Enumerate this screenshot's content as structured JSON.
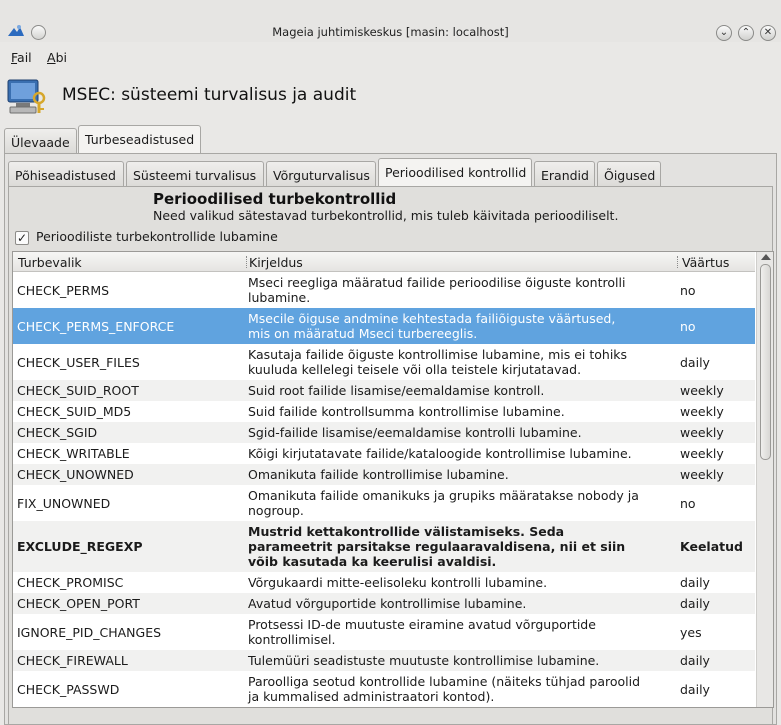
{
  "window": {
    "title": "Mageia juhtimiskeskus  [masin: localhost]"
  },
  "menu": {
    "file_rest": "ail",
    "file_key": "F",
    "help_rest": "bi",
    "help_key": "A"
  },
  "app": {
    "title": "MSEC: süsteemi turvalisus ja audit"
  },
  "top_tabs": [
    "Ülevaade",
    "Turbeseadistused"
  ],
  "sub_tabs": [
    "Põhiseadistused",
    "Süsteemi turvalisus",
    "Võrguturvalisus",
    "Perioodilised kontrollid",
    "Erandid",
    "Õigused"
  ],
  "section": {
    "title": "Perioodilised turbekontrollid",
    "description": "Need valikud sätestavad turbekontrollid, mis tuleb käivitada perioodiliselt.",
    "checkbox_label": "Perioodiliste turbekontrollide lubamine"
  },
  "table": {
    "columns": [
      "Turbevalik",
      "Kirjeldus",
      "Väärtus"
    ],
    "rows": [
      {
        "name": "CHECK_PERMS",
        "desc": [
          "Mseci reegliga määratud failide perioodilise õiguste kontrolli",
          "lubamine."
        ],
        "value": "no"
      },
      {
        "name": "CHECK_PERMS_ENFORCE",
        "desc": [
          "Msecile õiguse andmine kehtestada failiõiguste väärtused,",
          "mis on määratud Mseci turbereeglis."
        ],
        "value": "no"
      },
      {
        "name": "CHECK_USER_FILES",
        "desc": [
          "Kasutaja failide õiguste kontrollimise lubamine, mis ei tohiks",
          "kuuluda kellelegi teisele või olla teistele kirjutatavad."
        ],
        "value": "daily"
      },
      {
        "name": "CHECK_SUID_ROOT",
        "desc": [
          "Suid root failide lisamise/eemaldamise kontroll."
        ],
        "value": "weekly"
      },
      {
        "name": "CHECK_SUID_MD5",
        "desc": [
          "Suid failide kontrollsumma kontrollimise lubamine."
        ],
        "value": "weekly"
      },
      {
        "name": "CHECK_SGID",
        "desc": [
          "Sgid-failide lisamise/eemaldamise kontrolli lubamine."
        ],
        "value": "weekly"
      },
      {
        "name": "CHECK_WRITABLE",
        "desc": [
          "Kõigi kirjutatavate failide/kataloogide kontrollimise lubamine."
        ],
        "value": "weekly"
      },
      {
        "name": "CHECK_UNOWNED",
        "desc": [
          "Omanikuta failide kontrollimise lubamine."
        ],
        "value": "weekly"
      },
      {
        "name": "FIX_UNOWNED",
        "desc": [
          "Omanikuta failide omanikuks ja grupiks määratakse nobody ja",
          "nogroup."
        ],
        "value": "no"
      },
      {
        "name": "EXCLUDE_REGEXP",
        "desc": [
          "Mustrid kettakontrollide välistamiseks. Seda",
          "parameetrit parsitakse regulaaravaldisena, nii et siin",
          "võib kasutada ka keerulisi avaldisi."
        ],
        "value": "Keelatud"
      },
      {
        "name": "CHECK_PROMISC",
        "desc": [
          "Võrgukaardi mitte-eelisoleku kontrolli lubamine."
        ],
        "value": "daily"
      },
      {
        "name": "CHECK_OPEN_PORT",
        "desc": [
          "Avatud võrguportide kontrollimise lubamine."
        ],
        "value": "daily"
      },
      {
        "name": "IGNORE_PID_CHANGES",
        "desc": [
          "Protsessi ID-de muutuste eiramine avatud võrguportide",
          "kontrollimisel."
        ],
        "value": "yes"
      },
      {
        "name": "CHECK_FIREWALL",
        "desc": [
          "Tulemüüri seadistuste muutuste kontrollimise lubamine."
        ],
        "value": "daily"
      },
      {
        "name": "CHECK_PASSWD",
        "desc": [
          "Paroolliga seotud kontrollide lubamine (näiteks tühjad paroolid",
          "ja kummalised administraatori kontod)."
        ],
        "value": "daily"
      }
    ]
  },
  "colors": {
    "selection": "#60a3df",
    "alt_row": "#f1f1f0"
  }
}
